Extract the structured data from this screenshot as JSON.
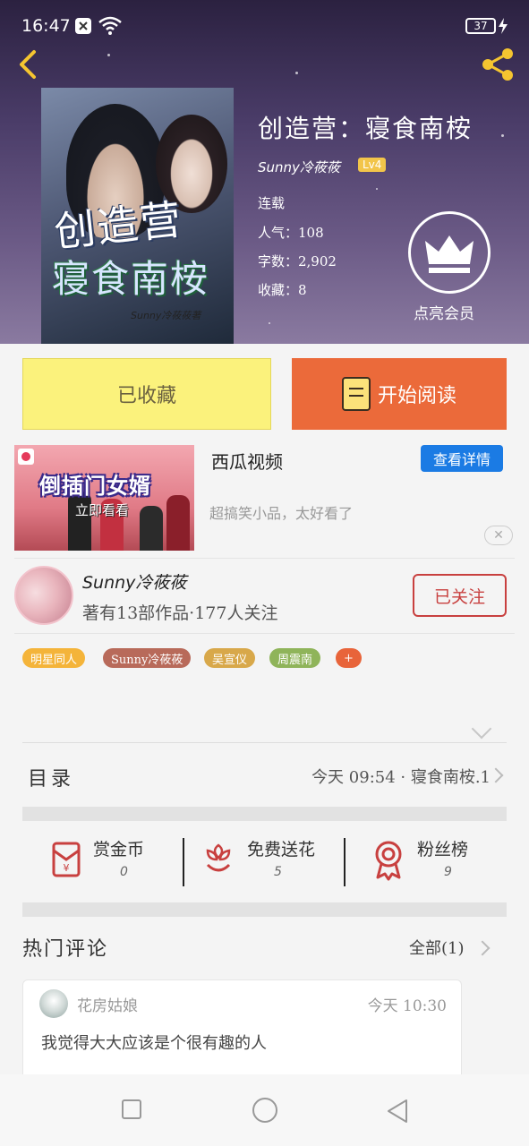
{
  "status_bar": {
    "time": "16:47",
    "battery": "37"
  },
  "book": {
    "title": "创造营：寝食南桉",
    "author": "Sunny冷莜莜",
    "level": "Lv4",
    "status": "连载",
    "popularity": "人气：108",
    "word_count": "字数：2,902",
    "favorites": "收藏：8",
    "cover": {
      "title_line1": "创造营",
      "title_line2": "寝食南桉",
      "signature": "Sunny冷莜莜著"
    }
  },
  "vip": {
    "label": "点亮会员"
  },
  "actions": {
    "collected_label": "已收藏",
    "read_label": "开始阅读"
  },
  "ad": {
    "app_name": "西瓜视频",
    "detail_button": "查看详情",
    "description": "超搞笑小品，太好看了",
    "image_headline": "倒插门女婿",
    "image_subtitle": "立即看看",
    "close_label": "✕"
  },
  "author_card": {
    "name": "Sunny冷莜莜",
    "stats": "著有13部作品·177人关注",
    "follow_label": "已关注"
  },
  "tags": [
    {
      "label": "明星同人",
      "color": "#f4b43a"
    },
    {
      "label": "Sunny冷莜莜",
      "color": "#b86a5a"
    },
    {
      "label": "吴宣仪",
      "color": "#d8a84a"
    },
    {
      "label": "周震南",
      "color": "#8fb45a"
    },
    {
      "label": "+",
      "color": "#e8643a"
    }
  ],
  "toc": {
    "label": "目录",
    "latest": "今天 09:54 · 寝食南桉.1"
  },
  "stats": [
    {
      "label": "赏金币",
      "value": "0",
      "icon": "red-envelope-icon"
    },
    {
      "label": "免费送花",
      "value": "5",
      "icon": "flower-icon"
    },
    {
      "label": "粉丝榜",
      "value": "9",
      "icon": "medal-icon"
    }
  ],
  "comments": {
    "section_title": "热门评论",
    "all_label": "全部(1)",
    "items": [
      {
        "user": "花房姑娘",
        "time": "今天 10:30",
        "text": "我觉得大大应该是个很有趣的人"
      }
    ]
  },
  "colors": {
    "read_button": "#eb6a3a",
    "collected_button": "#fbf27c",
    "accent_red": "#c8403f",
    "ad_button": "#1b7be4"
  }
}
